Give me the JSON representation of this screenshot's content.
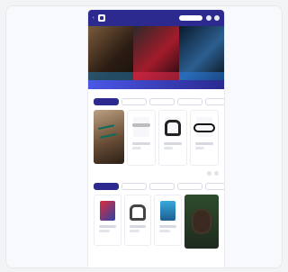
{
  "app": {
    "topbar": {
      "brand_name": "",
      "search_placeholder": "",
      "icons": [
        "back-chevron-icon",
        "brand-logo-icon",
        "search-pill",
        "user-icon",
        "cart-icon"
      ]
    },
    "hero": {
      "tiles": [
        {
          "label": ""
        },
        {
          "label": ""
        },
        {
          "label": ""
        }
      ],
      "strip_text": ""
    },
    "section1": {
      "kicker": "",
      "title": "",
      "tabs": [
        "",
        "",
        "",
        "",
        ""
      ],
      "active_tab_index": 0
    },
    "section2": {
      "kicker": "",
      "title": "",
      "tabs": [
        "",
        "",
        "",
        "",
        "",
        ""
      ],
      "active_tab_index": 0
    }
  }
}
